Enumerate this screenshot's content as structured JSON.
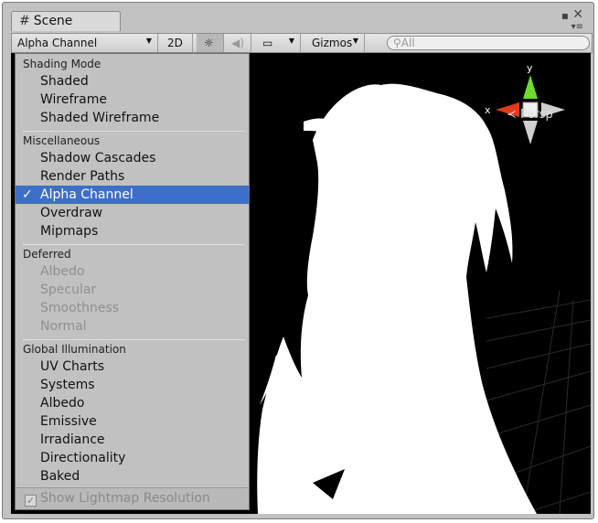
{
  "window": {
    "tab_title": "Scene"
  },
  "toolbar": {
    "draw_mode": "Alpha Channel",
    "mode_2d": "2D",
    "gizmos": "Gizmos",
    "search_placeholder": "All"
  },
  "scene": {
    "projection_label": "Persp",
    "axis_y": "y",
    "axis_x": "x"
  },
  "menu": {
    "sections": [
      {
        "header": "Shading Mode",
        "items": [
          "Shaded",
          "Wireframe",
          "Shaded Wireframe"
        ]
      },
      {
        "header": "Miscellaneous",
        "items": [
          "Shadow Cascades",
          "Render Paths",
          "Alpha Channel",
          "Overdraw",
          "Mipmaps"
        ]
      },
      {
        "header": "Deferred",
        "items": [
          "Albedo",
          "Specular",
          "Smoothness",
          "Normal"
        ]
      },
      {
        "header": "Global Illumination",
        "items": [
          "UV Charts",
          "Systems",
          "Albedo",
          "Emissive",
          "Irradiance",
          "Directionality",
          "Baked"
        ]
      }
    ],
    "selected_item": "Alpha Channel",
    "check_mark": "✓",
    "bottom_option": "Show Lightmap Resolution"
  },
  "colors": {
    "selection": "#3d6fc8",
    "y_axis": "#6ddc2c",
    "x_axis": "#e23a1a"
  }
}
